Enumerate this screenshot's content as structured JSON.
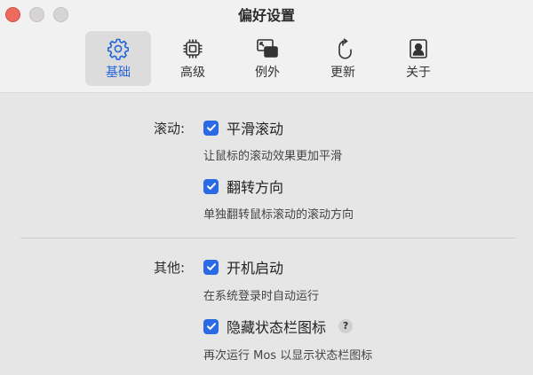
{
  "window": {
    "title": "偏好设置"
  },
  "toolbar": {
    "tabs": [
      {
        "label": "基础",
        "icon": "gear-icon",
        "active": true
      },
      {
        "label": "高级",
        "icon": "chip-icon",
        "active": false
      },
      {
        "label": "例外",
        "icon": "window-overlap-icon",
        "active": false
      },
      {
        "label": "更新",
        "icon": "mouse-refresh-icon",
        "active": false
      },
      {
        "label": "关于",
        "icon": "user-card-icon",
        "active": false
      }
    ]
  },
  "sections": {
    "scroll": {
      "label": "滚动:",
      "options": [
        {
          "label": "平滑滚动",
          "checked": true,
          "description": "让鼠标的滚动效果更加平滑"
        },
        {
          "label": "翻转方向",
          "checked": true,
          "description": "单独翻转鼠标滚动的滚动方向"
        }
      ]
    },
    "other": {
      "label": "其他:",
      "options": [
        {
          "label": "开机启动",
          "checked": true,
          "description": "在系统登录时自动运行"
        },
        {
          "label": "隐藏状态栏图标",
          "checked": true,
          "description": "再次运行 Mos 以显示状态栏图标",
          "help": "?"
        }
      ]
    }
  },
  "colors": {
    "accent": "#2a6ae4",
    "active_tab_label": "#2464d6"
  }
}
